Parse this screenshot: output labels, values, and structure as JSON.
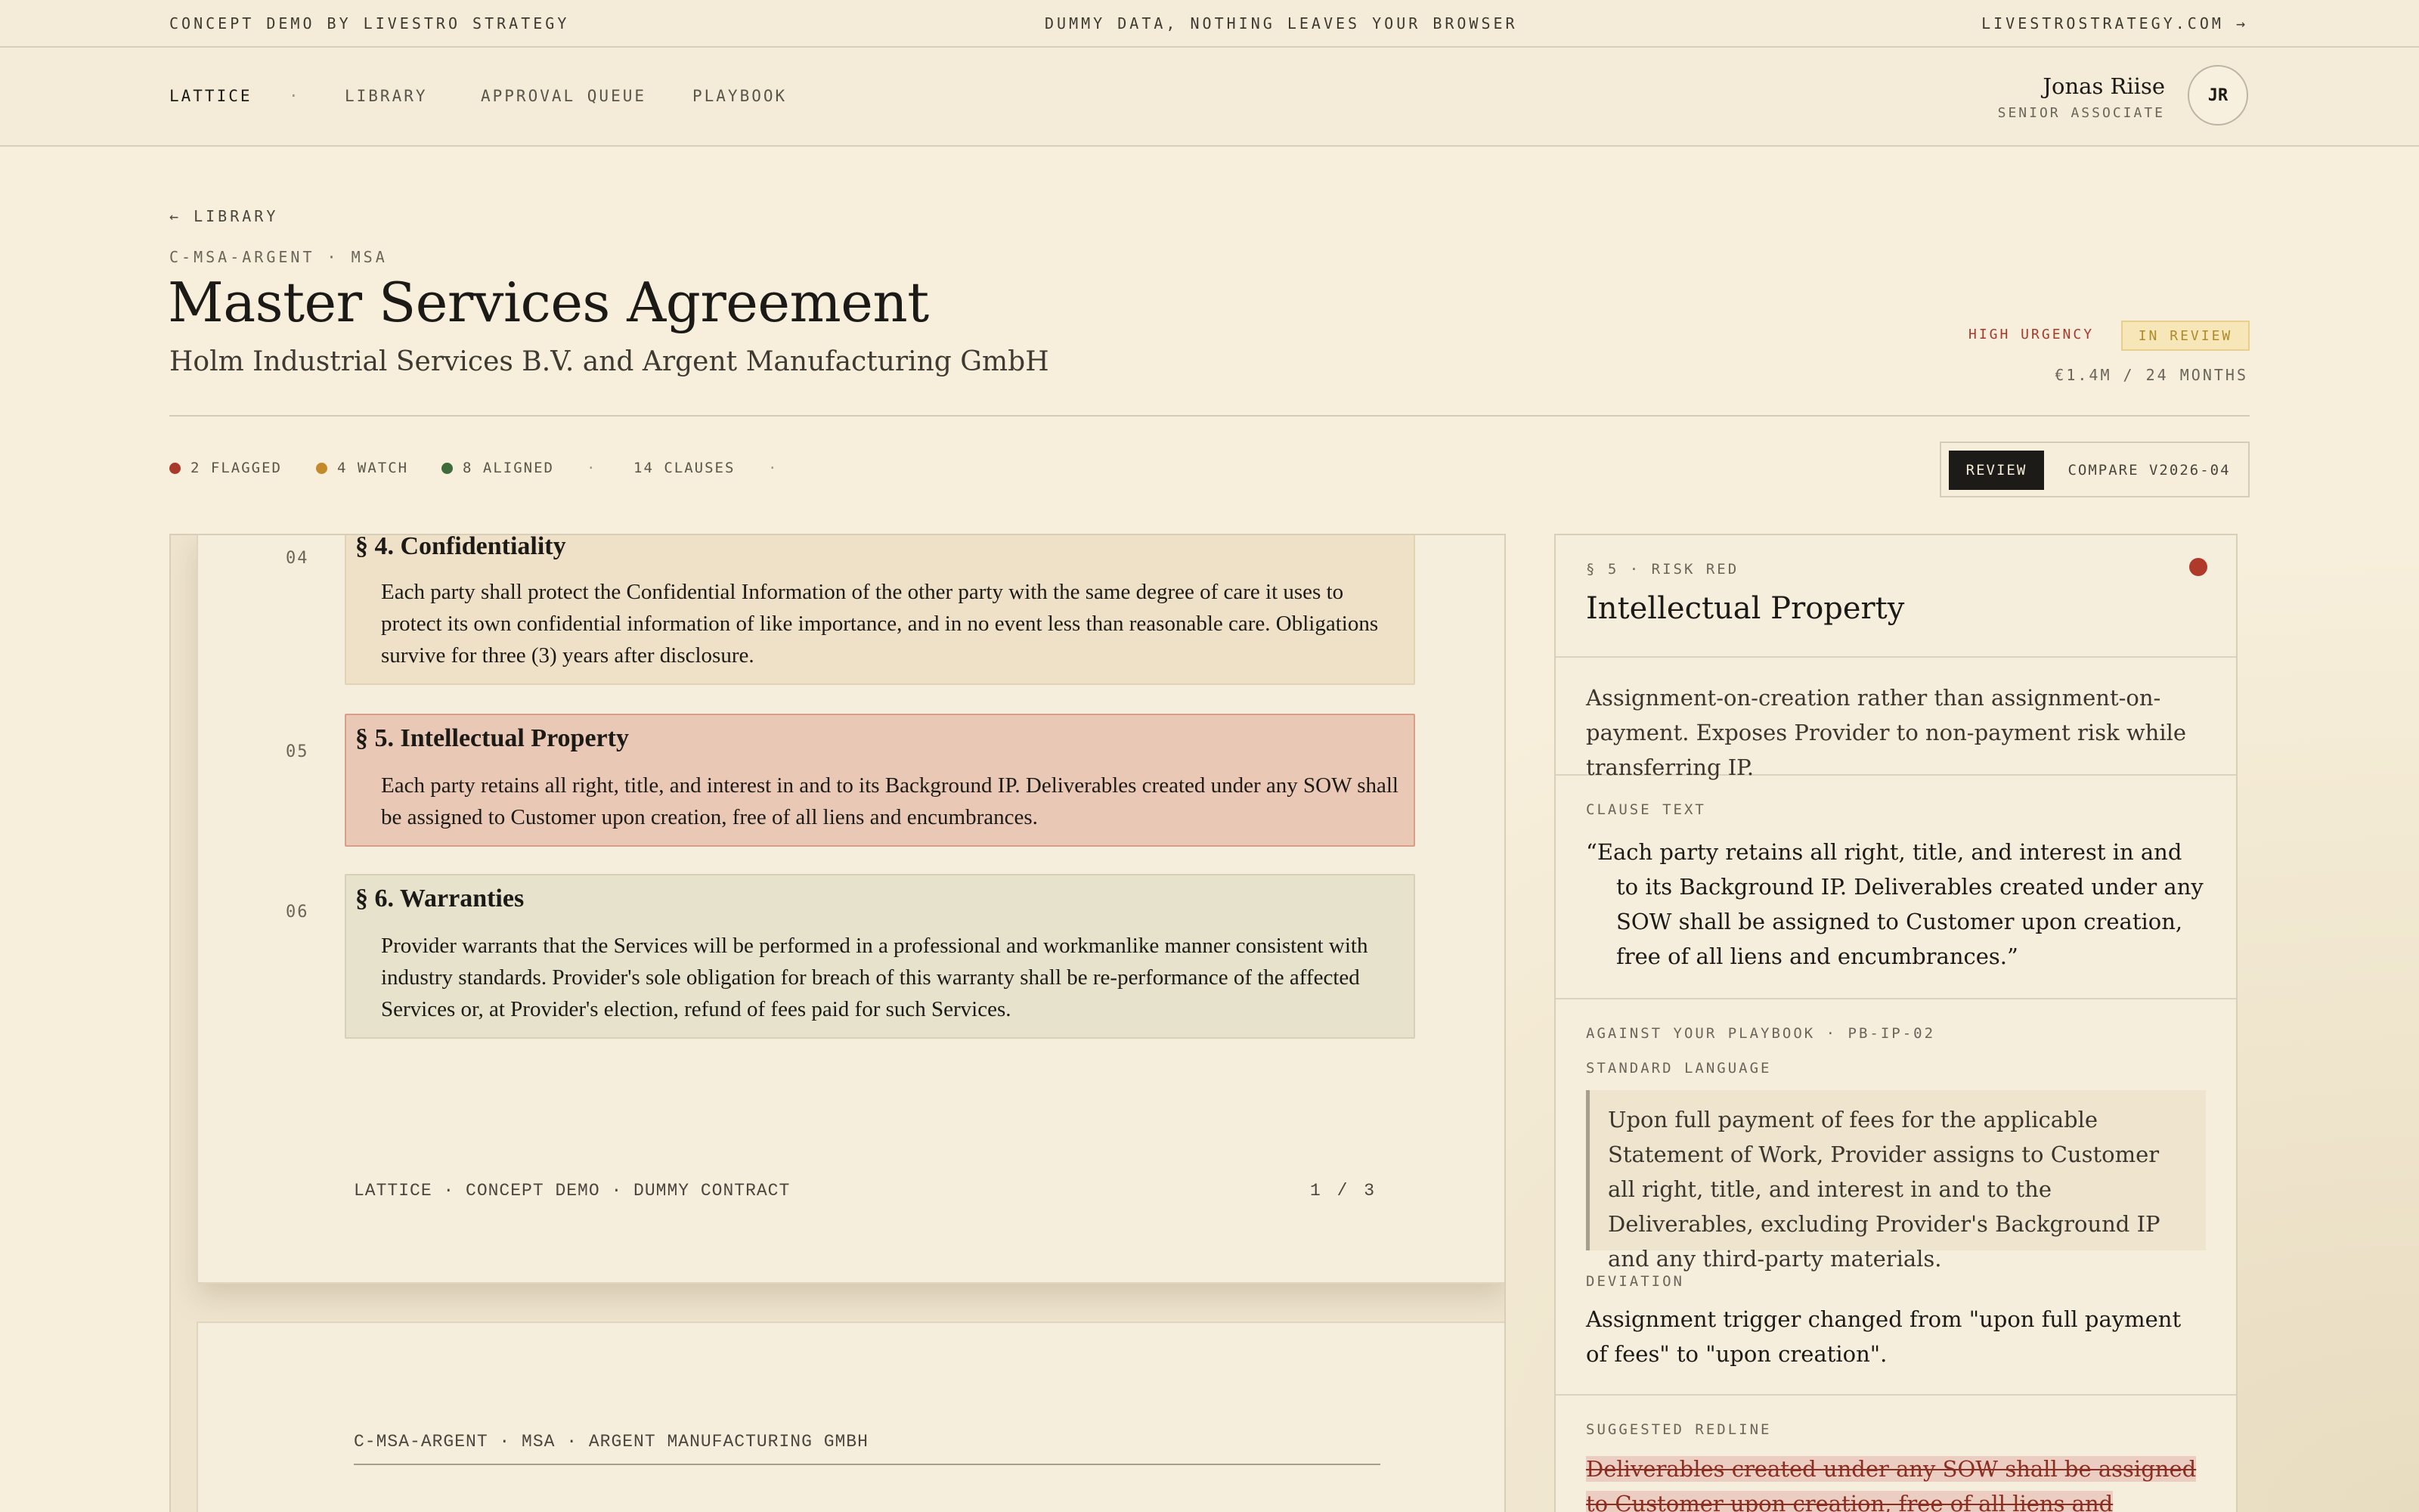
{
  "banner": {
    "left": "CONCEPT DEMO BY LIVESTRO STRATEGY",
    "center": "DUMMY DATA, NOTHING LEAVES YOUR BROWSER",
    "right": "LIVESTROSTRATEGY.COM →"
  },
  "nav": {
    "brand": "LATTICE",
    "separator": "·",
    "items": [
      "LIBRARY",
      "APPROVAL QUEUE",
      "PLAYBOOK"
    ]
  },
  "user": {
    "name": "Jonas Riise",
    "role": "SENIOR ASSOCIATE",
    "initials": "JR"
  },
  "header": {
    "back": "← LIBRARY",
    "doc_id": "C-MSA-ARGENT · MSA",
    "title": "Master Services Agreement",
    "parties": "Holm Industrial Services B.V. and Argent Manufacturing GmbH",
    "urgency": "HIGH URGENCY",
    "status": "IN REVIEW",
    "value": "€1.4M / 24 MONTHS"
  },
  "stats": {
    "flagged": "2 FLAGGED",
    "watch": "4 WATCH",
    "aligned": "8 ALIGNED",
    "sep": "·",
    "clauses": "14 CLAUSES",
    "colors": {
      "flagged": "#a8392b",
      "watch": "#c48a2a",
      "aligned": "#3e6b3a"
    }
  },
  "view_toggle": {
    "active": "REVIEW",
    "inactive": "COMPARE V2026-04"
  },
  "document": {
    "clauses": [
      {
        "num": "04",
        "heading": "§ 4. Confidentiality",
        "text": "Each party shall protect the Confidential Information of the other party with the same degree of care it uses to protect its own confidential information of like importance, and in no event less than reasonable care. Obligations survive for three (3) years after disclosure."
      },
      {
        "num": "05",
        "heading": "§ 5. Intellectual Property",
        "text": "Each party retains all right, title, and interest in and to its Background IP. Deliverables created under any SOW shall be assigned to Customer upon creation, free of all liens and encumbrances."
      },
      {
        "num": "06",
        "heading": "§ 6. Warranties",
        "text": "Provider warrants that the Services will be performed in a professional and workmanlike manner consistent with industry standards. Provider's sole obligation for breach of this warranty shall be re-performance of the affected Services or, at Provider's election, refund of fees paid for such Services."
      }
    ],
    "footer_left": "LATTICE · CONCEPT DEMO · DUMMY CONTRACT",
    "footer_right": "1 / 3",
    "page2_header": "C-MSA-ARGENT · MSA · ARGENT MANUFACTURING GMBH"
  },
  "panel": {
    "section_label": "§ 5 · RISK RED",
    "title": "Intellectual Property",
    "summary": "Assignment-on-creation rather than assignment-on-payment. Exposes Provider to non-payment risk while transferring IP.",
    "clause_label": "CLAUSE TEXT",
    "clause_text": "“Each party retains all right, title, and interest in and to its Background IP. Deliverables created under any SOW shall be assigned to Customer upon creation, free of all liens and encumbrances.”",
    "playbook_label": "AGAINST YOUR PLAYBOOK · PB-IP-02",
    "standard_label": "STANDARD LANGUAGE",
    "standard_text": "Upon full payment of fees for the applicable Statement of Work, Provider assigns to Customer all right, title, and interest in and to the Deliverables, excluding Provider's Background IP and any third-party materials.",
    "deviation_label": "DEVIATION",
    "deviation_text": "Assignment trigger changed from \"upon full payment of fees\" to \"upon creation\".",
    "redline_label": "SUGGESTED REDLINE",
    "redline_text": "Deliverables created under any SOW shall be assigned to Customer upon creation, free of all liens and encumbrances.",
    "risk_color": "#b03a2a"
  }
}
